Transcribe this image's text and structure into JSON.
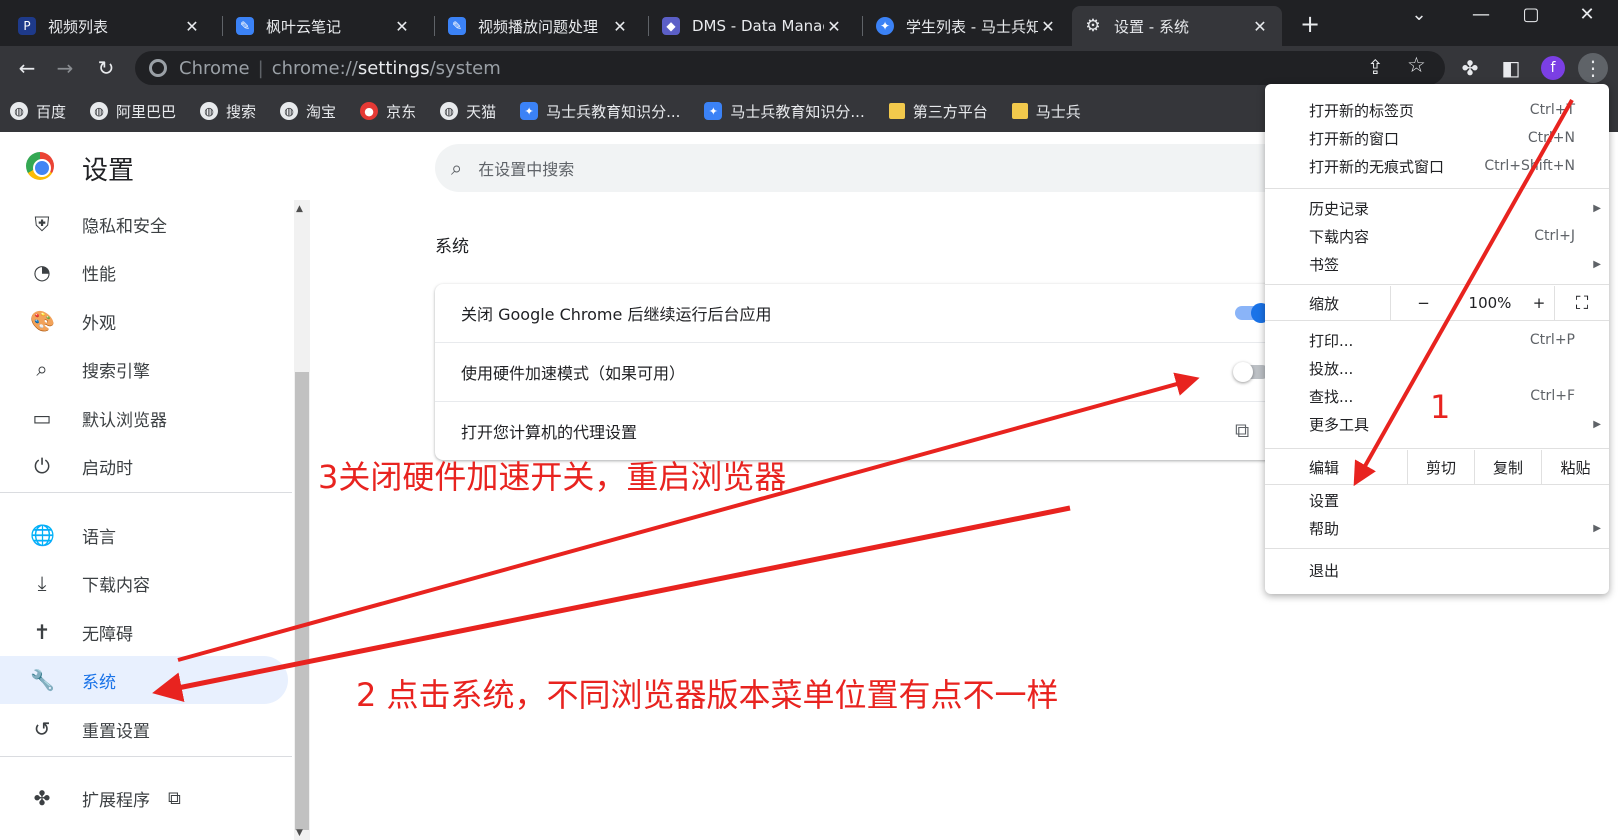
{
  "tabs": [
    {
      "title": "视频列表",
      "icon": "p-icon",
      "color": "#3b82f6"
    },
    {
      "title": "枫叶云笔记",
      "icon": "note-app-icon",
      "color": "#3b82f6"
    },
    {
      "title": "视频播放问题处理",
      "icon": "note-app-icon",
      "color": "#3b82f6"
    },
    {
      "title": "DMS - Data Manag",
      "icon": "dms-icon",
      "color": "#5b5fc7"
    },
    {
      "title": "学生列表 - 马士兵知",
      "icon": "msb-icon",
      "color": "#3b82f6"
    },
    {
      "title": "设置 - 系统",
      "icon": "gear-icon",
      "color": "#35363a"
    }
  ],
  "new_tab": "+",
  "close_glyph": "✕",
  "omnibox": {
    "site": "Chrome",
    "scheme": "chrome://",
    "host": "settings",
    "path": "/system"
  },
  "profile_letter": "f",
  "bookmarks": [
    {
      "label": "百度",
      "icon": "globe-icon"
    },
    {
      "label": "阿里巴巴",
      "icon": "globe-icon"
    },
    {
      "label": "搜索",
      "icon": "globe-icon"
    },
    {
      "label": "淘宝",
      "icon": "globe-icon"
    },
    {
      "label": "京东",
      "icon": "jd-icon"
    },
    {
      "label": "天猫",
      "icon": "globe-icon"
    },
    {
      "label": "马士兵教育知识分...",
      "icon": "msb-icon"
    },
    {
      "label": "马士兵教育知识分...",
      "icon": "msb-icon"
    },
    {
      "label": "第三方平台",
      "icon": "folder-icon"
    },
    {
      "label": "马士兵",
      "icon": "folder-icon"
    }
  ],
  "settings": {
    "title": "设置",
    "search_placeholder": "在设置中搜索",
    "nav": [
      {
        "label": "隐私和安全",
        "icon": "shield-icon",
        "glyph": "⛨"
      },
      {
        "label": "性能",
        "icon": "speedometer-icon",
        "glyph": "◔"
      },
      {
        "label": "外观",
        "icon": "palette-icon",
        "glyph": "🎨"
      },
      {
        "label": "搜索引擎",
        "icon": "search-icon",
        "glyph": "⌕"
      },
      {
        "label": "默认浏览器",
        "icon": "browser-icon",
        "glyph": "▭"
      },
      {
        "label": "启动时",
        "icon": "power-icon",
        "glyph": "⏻"
      },
      {
        "label": "语言",
        "icon": "globe-icon",
        "glyph": "🌐"
      },
      {
        "label": "下载内容",
        "icon": "download-icon",
        "glyph": "⤓"
      },
      {
        "label": "无障碍",
        "icon": "accessibility-icon",
        "glyph": "✝"
      },
      {
        "label": "系统",
        "icon": "wrench-icon",
        "glyph": "🔧"
      },
      {
        "label": "重置设置",
        "icon": "restore-icon",
        "glyph": "↺"
      },
      {
        "label": "扩展程序",
        "icon": "puzzle-icon",
        "glyph": "✤"
      }
    ],
    "section_title": "系统",
    "rows": [
      {
        "label": "关闭 Google Chrome 后继续运行后台应用",
        "toggle": true
      },
      {
        "label": "使用硬件加速模式（如果可用）",
        "toggle": false
      },
      {
        "label": "打开您计算机的代理设置",
        "external": true
      }
    ]
  },
  "menu": {
    "group1": [
      {
        "label": "打开新的标签页",
        "shortcut": "Ctrl+T"
      },
      {
        "label": "打开新的窗口",
        "shortcut": "Ctrl+N"
      },
      {
        "label": "打开新的无痕式窗口",
        "shortcut": "Ctrl+Shift+N"
      }
    ],
    "group2": [
      {
        "label": "历史记录",
        "shortcut": "",
        "submenu": true
      },
      {
        "label": "下载内容",
        "shortcut": "Ctrl+J",
        "submenu": false
      },
      {
        "label": "书签",
        "shortcut": "",
        "submenu": true
      }
    ],
    "zoom": {
      "label": "缩放",
      "minus": "−",
      "value": "100%",
      "plus": "+"
    },
    "group3": [
      {
        "label": "打印...",
        "shortcut": "Ctrl+P",
        "submenu": false
      },
      {
        "label": "投放...",
        "shortcut": "",
        "submenu": false
      },
      {
        "label": "查找...",
        "shortcut": "Ctrl+F",
        "submenu": false
      },
      {
        "label": "更多工具",
        "shortcut": "",
        "submenu": true
      }
    ],
    "edit": {
      "label": "编辑",
      "cut": "剪切",
      "copy": "复制",
      "paste": "粘贴"
    },
    "group4": [
      {
        "label": "设置",
        "submenu": false
      },
      {
        "label": "帮助",
        "submenu": true
      }
    ],
    "exit": "退出"
  },
  "annotations": {
    "step1": "1",
    "step2": "2 点击系统，不同浏览器版本菜单位置有点不一样",
    "step3": "3关闭硬件加速开关，重启浏览器",
    "color": "#e8231f"
  }
}
